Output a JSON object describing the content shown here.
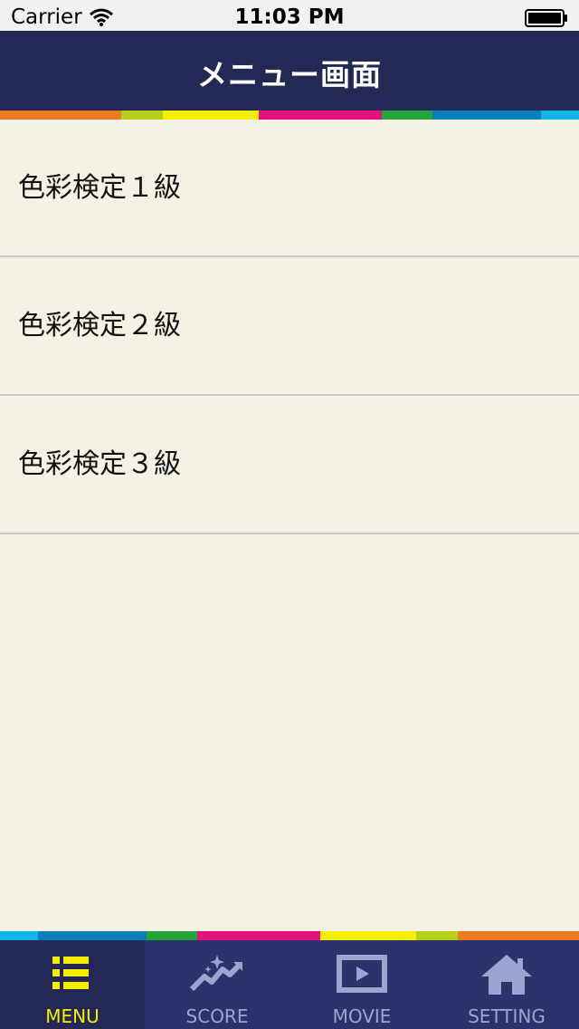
{
  "status_bar": {
    "carrier": "Carrier",
    "time": "11:03 PM"
  },
  "nav": {
    "title": "メニュー画面"
  },
  "menu_items": [
    {
      "label": "色彩検定１級"
    },
    {
      "label": "色彩検定２級"
    },
    {
      "label": "色彩検定３級"
    }
  ],
  "tabs": [
    {
      "label": "MENU",
      "icon": "list-icon",
      "active": true
    },
    {
      "label": "SCORE",
      "icon": "chart-trend-icon",
      "active": false
    },
    {
      "label": "MOVIE",
      "icon": "play-icon",
      "active": false
    },
    {
      "label": "SETTING",
      "icon": "home-icon",
      "active": false
    }
  ],
  "colors": {
    "nav_background": "#232855",
    "tab_background": "#2c326b",
    "list_background": "#f4f1e5",
    "active_tab_color": "#f5ee00",
    "inactive_tab_color": "#9ea3cf",
    "stripe": [
      "#ec7b1f",
      "#b4cf1c",
      "#f5ee00",
      "#e4127d",
      "#24a33a",
      "#0a80b8",
      "#11b4e7"
    ]
  }
}
